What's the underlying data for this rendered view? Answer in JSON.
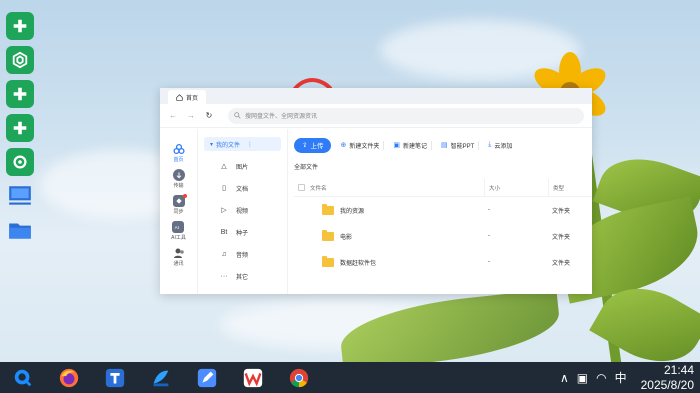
{
  "desktop": {
    "icons": [
      "add-icon",
      "box-icon",
      "add-icon",
      "add-icon",
      "refresh-icon",
      "computer-icon",
      "folder-icon"
    ]
  },
  "window": {
    "tab_label": "首页",
    "search_placeholder": "搜网盘文件、全网资源资讯",
    "rail": [
      {
        "label": "首页",
        "icon": "cloud-icon"
      },
      {
        "label": "传输",
        "icon": "transfer-icon"
      },
      {
        "label": "同步",
        "icon": "sync-icon"
      },
      {
        "label": "AI工具",
        "icon": "ai-icon"
      },
      {
        "label": "通讯",
        "icon": "contacts-icon"
      }
    ],
    "sidebar": {
      "head": "我的文件",
      "items": [
        {
          "label": "图片",
          "glyph": "△"
        },
        {
          "label": "文档",
          "glyph": "▯"
        },
        {
          "label": "视频",
          "glyph": "▷"
        },
        {
          "label": "种子",
          "glyph": "Bt"
        },
        {
          "label": "音频",
          "glyph": "♫"
        },
        {
          "label": "其它",
          "glyph": "···"
        }
      ]
    },
    "toolbar": {
      "upload": "上传",
      "new_folder": "新建文件夹",
      "new_note": "新建笔记",
      "smart_ppt": "智能PPT",
      "cloud_add": "云添加"
    },
    "breadcrumb": "全部文件",
    "table": {
      "headers": {
        "name": "文件名",
        "size": "大小",
        "type": "类型"
      },
      "rows": [
        {
          "name": "我的资源",
          "size": "-",
          "type": "文件夹"
        },
        {
          "name": "电影",
          "size": "-",
          "type": "文件夹"
        },
        {
          "name": "数据赶软件包",
          "size": "-",
          "type": "文件夹"
        }
      ]
    }
  },
  "taskbar": {
    "apps": [
      "search-app-icon",
      "firefox-icon",
      "app-icon",
      "app-icon",
      "pen-icon",
      "wps-icon",
      "chrome-icon"
    ],
    "ime": "中",
    "time": "21:44",
    "date": "2025/8/20"
  },
  "colors": {
    "accent": "#2f7cf6",
    "desktop_green": "#1ea55a",
    "taskbar": "#1f2a36",
    "folder": "#f7c23b"
  }
}
